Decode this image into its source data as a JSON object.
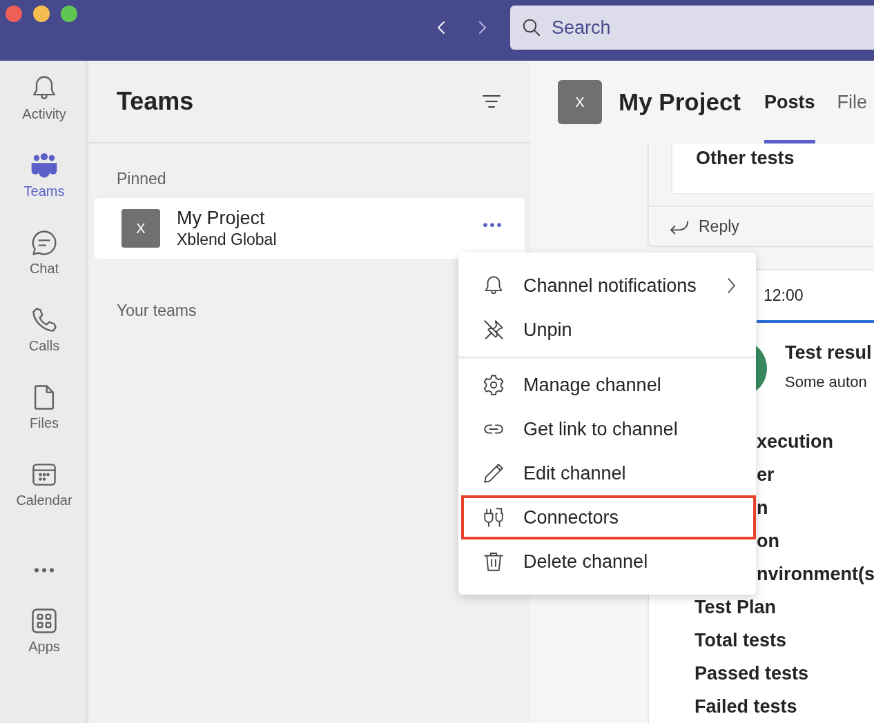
{
  "titlebar": {
    "search": {
      "placeholder": "Search"
    }
  },
  "rail": [
    {
      "kind": "bell",
      "label": "Activity",
      "selected": false
    },
    {
      "kind": "teams",
      "label": "Teams",
      "selected": true
    },
    {
      "kind": "chat",
      "label": "Chat",
      "selected": false
    },
    {
      "kind": "calls",
      "label": "Calls",
      "selected": false
    },
    {
      "kind": "files",
      "label": "Files",
      "selected": false
    },
    {
      "kind": "calendar",
      "label": "Calendar",
      "selected": false
    },
    {
      "kind": "more",
      "selected": false
    },
    {
      "kind": "apps",
      "label": "Apps",
      "selected": false
    }
  ],
  "teams_panel": {
    "title": "Teams",
    "sections": [
      {
        "heading": "Pinned",
        "teams": [
          {
            "avatar": "X",
            "name": "My Project",
            "org": "Xblend Global"
          }
        ]
      },
      {
        "heading": "Your teams"
      }
    ]
  },
  "channel": {
    "avatar": "X",
    "title": "My Project",
    "tabs": [
      {
        "label": "Posts",
        "selected": true
      },
      {
        "label": "File",
        "selected": false
      }
    ]
  },
  "feed": {
    "card_text": "Other tests",
    "reply": "Reply",
    "message": {
      "time": "12:00",
      "title": "Test resul",
      "subtitle": "Some auton",
      "partial_rows": [
        "xecution",
        "er",
        "n",
        "on",
        "nvironment(s"
      ],
      "rows": [
        "Test Plan",
        "Total tests",
        "Passed tests",
        "Failed tests"
      ]
    }
  },
  "menu": {
    "groups": [
      [
        {
          "kind": "bell",
          "label": "Channel notifications",
          "submenu": true,
          "highlighted": false
        },
        {
          "kind": "unpin",
          "label": "Unpin",
          "submenu": false,
          "highlighted": false
        }
      ],
      [
        {
          "kind": "gear",
          "label": "Manage channel",
          "submenu": false,
          "highlighted": false
        },
        {
          "kind": "link",
          "label": "Get link to channel",
          "submenu": false,
          "highlighted": false
        },
        {
          "kind": "pencil",
          "label": "Edit channel",
          "submenu": false,
          "highlighted": false
        },
        {
          "kind": "plugs",
          "label": "Connectors",
          "submenu": false,
          "highlighted": true
        },
        {
          "kind": "trash",
          "label": "Delete channel",
          "submenu": false,
          "highlighted": false
        }
      ]
    ]
  }
}
